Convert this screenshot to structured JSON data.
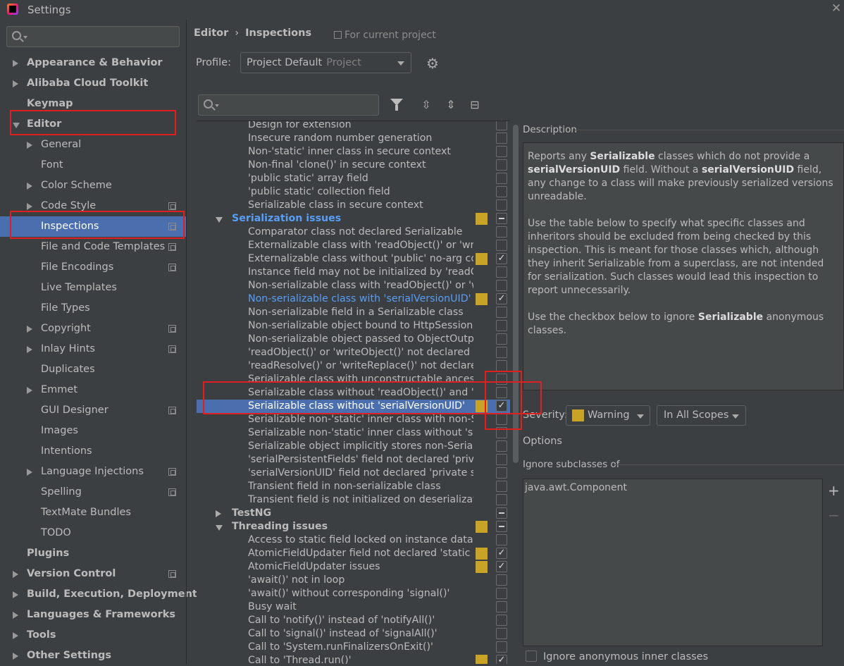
{
  "window": {
    "title": "Settings"
  },
  "sidebar": {
    "search_placeholder": "",
    "items": [
      {
        "label": "Appearance & Behavior",
        "bold": true,
        "arrow": "closed",
        "indent": 0,
        "proj": false
      },
      {
        "label": "Alibaba Cloud Toolkit",
        "bold": true,
        "arrow": "closed",
        "indent": 0,
        "proj": false
      },
      {
        "label": "Keymap",
        "bold": true,
        "arrow": "none",
        "indent": 0,
        "proj": false
      },
      {
        "label": "Editor",
        "bold": true,
        "arrow": "open",
        "indent": 0,
        "proj": false
      },
      {
        "label": "General",
        "bold": false,
        "arrow": "closed",
        "indent": 1,
        "proj": false
      },
      {
        "label": "Font",
        "bold": false,
        "arrow": "none",
        "indent": 1,
        "proj": false
      },
      {
        "label": "Color Scheme",
        "bold": false,
        "arrow": "closed",
        "indent": 1,
        "proj": false
      },
      {
        "label": "Code Style",
        "bold": false,
        "arrow": "closed",
        "indent": 1,
        "proj": true
      },
      {
        "label": "Inspections",
        "bold": false,
        "arrow": "none",
        "indent": 1,
        "proj": true,
        "selected": true
      },
      {
        "label": "File and Code Templates",
        "bold": false,
        "arrow": "none",
        "indent": 1,
        "proj": true
      },
      {
        "label": "File Encodings",
        "bold": false,
        "arrow": "none",
        "indent": 1,
        "proj": true
      },
      {
        "label": "Live Templates",
        "bold": false,
        "arrow": "none",
        "indent": 1,
        "proj": false
      },
      {
        "label": "File Types",
        "bold": false,
        "arrow": "none",
        "indent": 1,
        "proj": false
      },
      {
        "label": "Copyright",
        "bold": false,
        "arrow": "closed",
        "indent": 1,
        "proj": true
      },
      {
        "label": "Inlay Hints",
        "bold": false,
        "arrow": "closed",
        "indent": 1,
        "proj": true
      },
      {
        "label": "Duplicates",
        "bold": false,
        "arrow": "none",
        "indent": 1,
        "proj": false
      },
      {
        "label": "Emmet",
        "bold": false,
        "arrow": "closed",
        "indent": 1,
        "proj": false
      },
      {
        "label": "GUI Designer",
        "bold": false,
        "arrow": "none",
        "indent": 1,
        "proj": true
      },
      {
        "label": "Images",
        "bold": false,
        "arrow": "none",
        "indent": 1,
        "proj": false
      },
      {
        "label": "Intentions",
        "bold": false,
        "arrow": "none",
        "indent": 1,
        "proj": false
      },
      {
        "label": "Language Injections",
        "bold": false,
        "arrow": "closed",
        "indent": 1,
        "proj": true
      },
      {
        "label": "Spelling",
        "bold": false,
        "arrow": "none",
        "indent": 1,
        "proj": true
      },
      {
        "label": "TextMate Bundles",
        "bold": false,
        "arrow": "none",
        "indent": 1,
        "proj": false
      },
      {
        "label": "TODO",
        "bold": false,
        "arrow": "none",
        "indent": 1,
        "proj": false
      },
      {
        "label": "Plugins",
        "bold": true,
        "arrow": "none",
        "indent": 0,
        "proj": false
      },
      {
        "label": "Version Control",
        "bold": true,
        "arrow": "closed",
        "indent": 0,
        "proj": true
      },
      {
        "label": "Build, Execution, Deployment",
        "bold": true,
        "arrow": "closed",
        "indent": 0,
        "proj": false
      },
      {
        "label": "Languages & Frameworks",
        "bold": true,
        "arrow": "closed",
        "indent": 0,
        "proj": false
      },
      {
        "label": "Tools",
        "bold": true,
        "arrow": "closed",
        "indent": 0,
        "proj": false
      },
      {
        "label": "Other Settings",
        "bold": true,
        "arrow": "closed",
        "indent": 0,
        "proj": false
      }
    ]
  },
  "header": {
    "breadcrumb": [
      "Editor",
      "Inspections"
    ],
    "breadcrumb_sep": "›",
    "for_current_project": "For current project",
    "profile_label": "Profile:",
    "profile_value": "Project Default",
    "profile_sub": "Project"
  },
  "inspections": {
    "search_placeholder": "",
    "rows": [
      {
        "label": "Design for extension",
        "type": "item",
        "sev": false,
        "check": "off"
      },
      {
        "label": "Insecure random number generation",
        "type": "item",
        "sev": false,
        "check": "off"
      },
      {
        "label": "Non-'static' inner class in secure context",
        "type": "item",
        "sev": false,
        "check": "off"
      },
      {
        "label": "Non-final 'clone()' in secure context",
        "type": "item",
        "sev": false,
        "check": "off"
      },
      {
        "label": "'public static' array field",
        "type": "item",
        "sev": false,
        "check": "off"
      },
      {
        "label": "'public static' collection field",
        "type": "item",
        "sev": false,
        "check": "off"
      },
      {
        "label": "Serializable class in secure context",
        "type": "item",
        "sev": false,
        "check": "off"
      },
      {
        "label": "Serialization issues",
        "type": "cat-open",
        "blue": true,
        "sev": true,
        "check": "mixed"
      },
      {
        "label": "Comparator class not declared Serializable",
        "type": "item",
        "sev": false,
        "check": "off"
      },
      {
        "label": "Externalizable class with 'readObject()' or 'writeObject()'",
        "type": "item",
        "sev": false,
        "check": "off"
      },
      {
        "label": "Externalizable class without 'public' no-arg constructor",
        "type": "item",
        "sev": true,
        "check": "on"
      },
      {
        "label": "Instance field may not be initialized by 'readObject()'",
        "type": "item",
        "sev": false,
        "check": "off"
      },
      {
        "label": "Non-serializable class with 'readObject()' or 'writeObject()'",
        "type": "item",
        "sev": false,
        "check": "off"
      },
      {
        "label": "Non-serializable class with 'serialVersionUID'",
        "type": "item",
        "blue": true,
        "sev": true,
        "check": "on"
      },
      {
        "label": "Non-serializable field in a Serializable class",
        "type": "item",
        "sev": false,
        "check": "off"
      },
      {
        "label": "Non-serializable object bound to HttpSession",
        "type": "item",
        "sev": false,
        "check": "off"
      },
      {
        "label": "Non-serializable object passed to ObjectOutputStream",
        "type": "item",
        "sev": false,
        "check": "off"
      },
      {
        "label": "'readObject()' or 'writeObject()' not declared 'private'",
        "type": "item",
        "sev": false,
        "check": "off"
      },
      {
        "label": "'readResolve()' or 'writeReplace()' not declared 'protected'",
        "type": "item",
        "sev": false,
        "check": "off"
      },
      {
        "label": "Serializable class with unconstructable ancestor",
        "type": "item",
        "sev": false,
        "check": "off"
      },
      {
        "label": "Serializable class without 'readObject()' and 'writeObject()'",
        "type": "item",
        "sev": false,
        "check": "off"
      },
      {
        "label": "Serializable class without 'serialVersionUID'",
        "type": "item",
        "sev": true,
        "check": "on",
        "selected": true
      },
      {
        "label": "Serializable non-'static' inner class with non-Serializable outer class",
        "type": "item",
        "sev": false,
        "check": "off"
      },
      {
        "label": "Serializable non-'static' inner class without 'serialVersionUID'",
        "type": "item",
        "sev": false,
        "check": "off"
      },
      {
        "label": "Serializable object implicitly stores non-Serializable object",
        "type": "item",
        "sev": false,
        "check": "off"
      },
      {
        "label": "'serialPersistentFields' field not declared 'private static final ObjectStreamField[]'",
        "type": "item",
        "sev": false,
        "check": "off"
      },
      {
        "label": "'serialVersionUID' field not declared 'private static final long'",
        "type": "item",
        "sev": false,
        "check": "off"
      },
      {
        "label": "Transient field in non-serializable class",
        "type": "item",
        "sev": false,
        "check": "off"
      },
      {
        "label": "Transient field is not initialized on deserialization",
        "type": "item",
        "sev": false,
        "check": "off"
      },
      {
        "label": "TestNG",
        "type": "cat-closed",
        "sev": false,
        "check": "mixed"
      },
      {
        "label": "Threading issues",
        "type": "cat-open",
        "sev": true,
        "check": "mixed"
      },
      {
        "label": "Access to static field locked on instance data",
        "type": "item",
        "sev": false,
        "check": "off"
      },
      {
        "label": "AtomicFieldUpdater field not declared 'static final'",
        "type": "item",
        "sev": true,
        "check": "on"
      },
      {
        "label": "AtomicFieldUpdater issues",
        "type": "item",
        "sev": true,
        "check": "on"
      },
      {
        "label": "'await()' not in loop",
        "type": "item",
        "sev": false,
        "check": "off"
      },
      {
        "label": "'await()' without corresponding 'signal()'",
        "type": "item",
        "sev": false,
        "check": "off"
      },
      {
        "label": "Busy wait",
        "type": "item",
        "sev": false,
        "check": "off"
      },
      {
        "label": "Call to 'notify()' instead of 'notifyAll()'",
        "type": "item",
        "sev": false,
        "check": "off"
      },
      {
        "label": "Call to 'signal()' instead of 'signalAll()'",
        "type": "item",
        "sev": false,
        "check": "off"
      },
      {
        "label": "Call to 'System.runFinalizersOnExit()'",
        "type": "item",
        "sev": false,
        "check": "off"
      },
      {
        "label": "Call to 'Thread.run()'",
        "type": "item",
        "sev": true,
        "check": "on"
      }
    ]
  },
  "description": {
    "label": "Description",
    "paragraphs": [
      [
        {
          "t": "Reports any ",
          "b": false
        },
        {
          "t": "Serializable",
          "b": true
        },
        {
          "t": " classes which do not provide a ",
          "b": false
        },
        {
          "t": "serialVersionUID",
          "b": true
        },
        {
          "t": " field. Without a ",
          "b": false
        },
        {
          "t": "serialVersionUID",
          "b": true
        },
        {
          "t": " field, any change to a class will make previously serialized versions unreadable.",
          "b": false
        }
      ],
      [
        {
          "t": "Use the table below to specify what specific classes and inheritors should be excluded from being checked by this inspection. This is meant for those classes which, although they inherit Serializable from a superclass, are not intended for serialization. Such classes would lead this inspection to report unnecessarily.",
          "b": false
        }
      ],
      [
        {
          "t": "Use the checkbox below to ignore ",
          "b": false
        },
        {
          "t": "Serializable",
          "b": true
        },
        {
          "t": " anonymous classes.",
          "b": false
        }
      ]
    ]
  },
  "severity": {
    "label": "Severity:",
    "value": "Warning",
    "scope": "In All Scopes",
    "color": "#c9a325"
  },
  "options": {
    "label": "Options",
    "ignore_subclasses_label": "Ignore subclasses of",
    "ignore_list": [
      "java.awt.Component"
    ],
    "add": "+",
    "remove": "−",
    "ignore_anonymous_label": "Ignore anonymous inner classes"
  },
  "colors": {
    "selection": "#4b6eaf",
    "warning": "#c9a325",
    "link_blue": "#589df6",
    "annotation_red": "#e02020"
  }
}
